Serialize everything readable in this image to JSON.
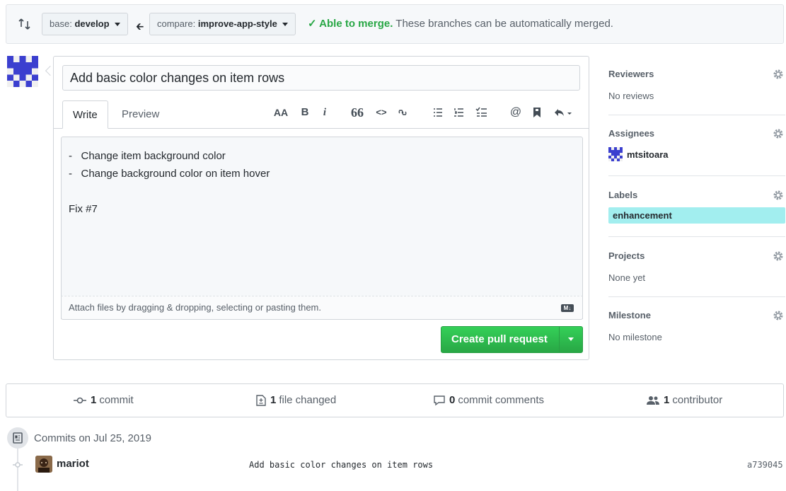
{
  "compare": {
    "base_prefix": "base:",
    "base_branch": "develop",
    "compare_prefix": "compare:",
    "compare_branch": "improve-app-style",
    "merge_ok": "✓ Able to merge.",
    "merge_msg": "These branches can be automatically merged."
  },
  "form": {
    "title_value": "Add basic color changes on item rows",
    "tabs": [
      {
        "label": "Write"
      },
      {
        "label": "Preview"
      }
    ],
    "toolbar": {
      "heading": "AA",
      "bold": "B",
      "italic": "i",
      "quote": "66",
      "code": "<>",
      "mention": "@"
    },
    "body_text": "-   Change item background color\n-   Change background color on item hover\n\nFix #7",
    "attach_hint": "Attach files by dragging & dropping, selecting or pasting them.",
    "markdown_badge": "M↓",
    "create_button": "Create pull request"
  },
  "sidebar": {
    "reviewers": {
      "title": "Reviewers",
      "value": "No reviews"
    },
    "assignees": {
      "title": "Assignees",
      "user": "mtsitoara"
    },
    "labels": {
      "title": "Labels",
      "label": "enhancement",
      "label_color": "#a2eeef"
    },
    "projects": {
      "title": "Projects",
      "value": "None yet"
    },
    "milestone": {
      "title": "Milestone",
      "value": "No milestone"
    }
  },
  "summary": {
    "commits_count": "1",
    "commits_label": "commit",
    "files_count": "1",
    "files_label": "file changed",
    "comments_count": "0",
    "comments_label": "commit comments",
    "contributors_count": "1",
    "contributors_label": "contributor"
  },
  "commits": {
    "date_header": "Commits on Jul 25, 2019",
    "items": [
      {
        "author": "mariot",
        "message": "Add basic color changes on item rows",
        "sha": "a739045"
      }
    ]
  },
  "colors": {
    "accent_green": "#28a745",
    "avatar_blue": "#3b3fcf"
  }
}
